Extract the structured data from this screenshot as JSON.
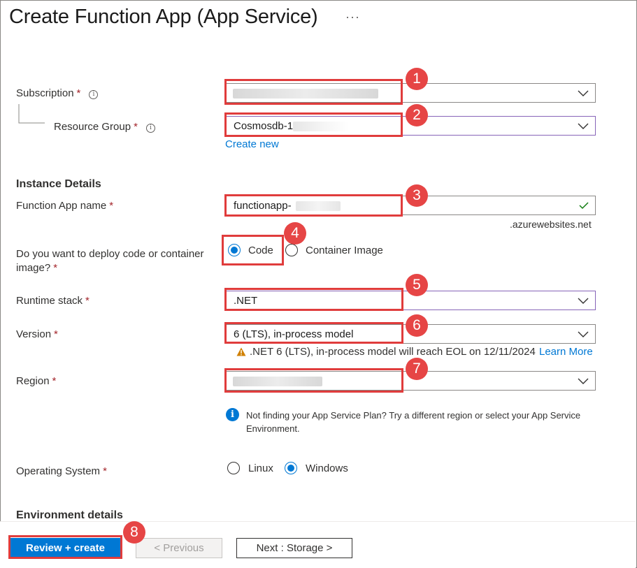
{
  "header": {
    "title": "Create Function App (App Service)",
    "more_label": "···"
  },
  "project": {
    "subscription_label": "Subscription",
    "resource_group_label": "Resource Group",
    "resource_group_value": "Cosmosdb-14",
    "create_new_label": "Create new"
  },
  "instance": {
    "section_title": "Instance Details",
    "app_name_label": "Function App name",
    "app_name_value": "functionapp-",
    "domain_suffix": ".azurewebsites.net",
    "deploy_label": "Do you want to deploy code or container image?",
    "deploy_options": {
      "code": "Code",
      "container": "Container Image"
    },
    "deploy_selected": "Code",
    "runtime_label": "Runtime stack",
    "runtime_value": ".NET",
    "version_label": "Version",
    "version_value": "6 (LTS), in-process model",
    "version_warning": ".NET 6 (LTS), in-process model will reach EOL on 12/11/2024",
    "learn_more_label": "Learn More",
    "region_label": "Region",
    "region_info": "Not finding your App Service Plan? Try a different region or select your App Service Environment.",
    "os_label": "Operating System",
    "os_options": {
      "linux": "Linux",
      "windows": "Windows"
    },
    "os_selected": "Windows"
  },
  "environment": {
    "section_title": "Environment details"
  },
  "footer": {
    "review_label": "Review + create",
    "previous_label": "< Previous",
    "next_label": "Next : Storage >"
  },
  "annotations": {
    "badges": [
      "1",
      "2",
      "3",
      "4",
      "5",
      "6",
      "7",
      "8"
    ],
    "color": "#e64545"
  },
  "colors": {
    "accent": "#0078d4",
    "required": "#a4262c",
    "warning": "#d08000",
    "success": "#107c10"
  }
}
